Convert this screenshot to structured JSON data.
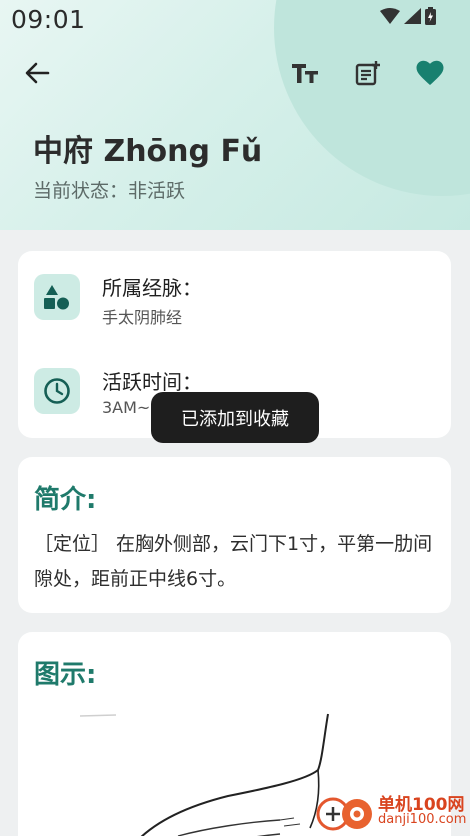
{
  "status_bar": {
    "time": "09:01"
  },
  "toolbar": {
    "back_icon": "arrow-back-icon",
    "font_icon": "font-size-icon",
    "note_icon": "note-add-icon",
    "favorite_icon": "heart-icon"
  },
  "header": {
    "title": "中府 Zhōng Fǔ",
    "status": "当前状态：非活跃"
  },
  "info_card": {
    "meridian_label": "所属经脉：",
    "meridian_value": "手太阴肺经",
    "active_label": "活跃时间：",
    "active_value": "3AM~5AM"
  },
  "intro": {
    "title": "简介:",
    "text": "［定位］ 在胸外侧部，云门下1寸，平第一肋间隙处，距前正中线6寸。"
  },
  "diagram": {
    "title": "图示:"
  },
  "toast": {
    "message": "已添加到收藏"
  },
  "watermark": {
    "title": "单机100网",
    "url": "danji100.com"
  },
  "colors": {
    "accent": "#1f7a6b",
    "header_bg": "#d6f0ea",
    "icon_bg": "#cdebe4"
  }
}
